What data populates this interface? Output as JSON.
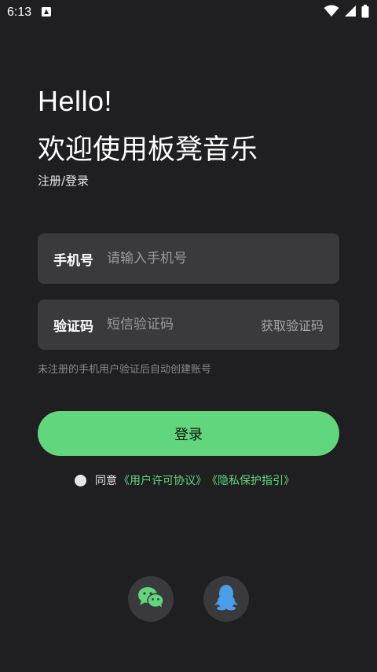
{
  "status_bar": {
    "time": "6:13"
  },
  "header": {
    "hello": "Hello!",
    "welcome": "欢迎使用板凳音乐",
    "subtitle": "注册/登录"
  },
  "form": {
    "phone_label": "手机号",
    "phone_placeholder": "请输入手机号",
    "phone_value": "",
    "code_label": "验证码",
    "code_placeholder": "短信验证码",
    "code_value": "",
    "get_code_label": "获取验证码",
    "hint": "未注册的手机用户验证后自动创建账号"
  },
  "login_button": {
    "label": "登录"
  },
  "agreement": {
    "prefix": "同意",
    "user_agreement": "《用户许可协议》",
    "privacy_policy": "《隐私保护指引》",
    "checked": false
  },
  "social_login": {
    "wechat_icon": "wechat-icon",
    "qq_icon": "qq-icon"
  },
  "colors": {
    "background": "#1f1e20",
    "field_background": "#3a393c",
    "accent_green": "#62d67d",
    "qq_blue": "#4a9de8"
  }
}
